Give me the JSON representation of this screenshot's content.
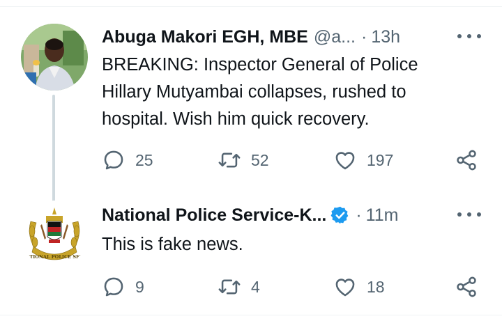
{
  "tweets": [
    {
      "author_name": "Abuga Makori EGH, MBE",
      "handle": "@a...",
      "time": "13h",
      "text_lines": [
        "BREAKING: Inspector General of Police",
        "Hillary Mutyambai collapses, rushed to",
        "hospital. Wish him quick recovery."
      ],
      "replies": "25",
      "retweets": "52",
      "likes": "197"
    },
    {
      "author_name": "National Police Service-K...",
      "verified": true,
      "time": "11m",
      "text": "This is fake news.",
      "replies": "9",
      "retweets": "4",
      "likes": "18"
    }
  ],
  "colors": {
    "text": "#0f1419",
    "secondary": "#536471",
    "verified": "#1d9bf0",
    "divider": "#eff3f4",
    "thread_line": "#cfd9de"
  },
  "icons": [
    "reply-icon",
    "retweet-icon",
    "like-icon",
    "share-icon",
    "more-icon",
    "verified-badge-icon"
  ],
  "seal_text": "NATIONAL POLICE SERV"
}
